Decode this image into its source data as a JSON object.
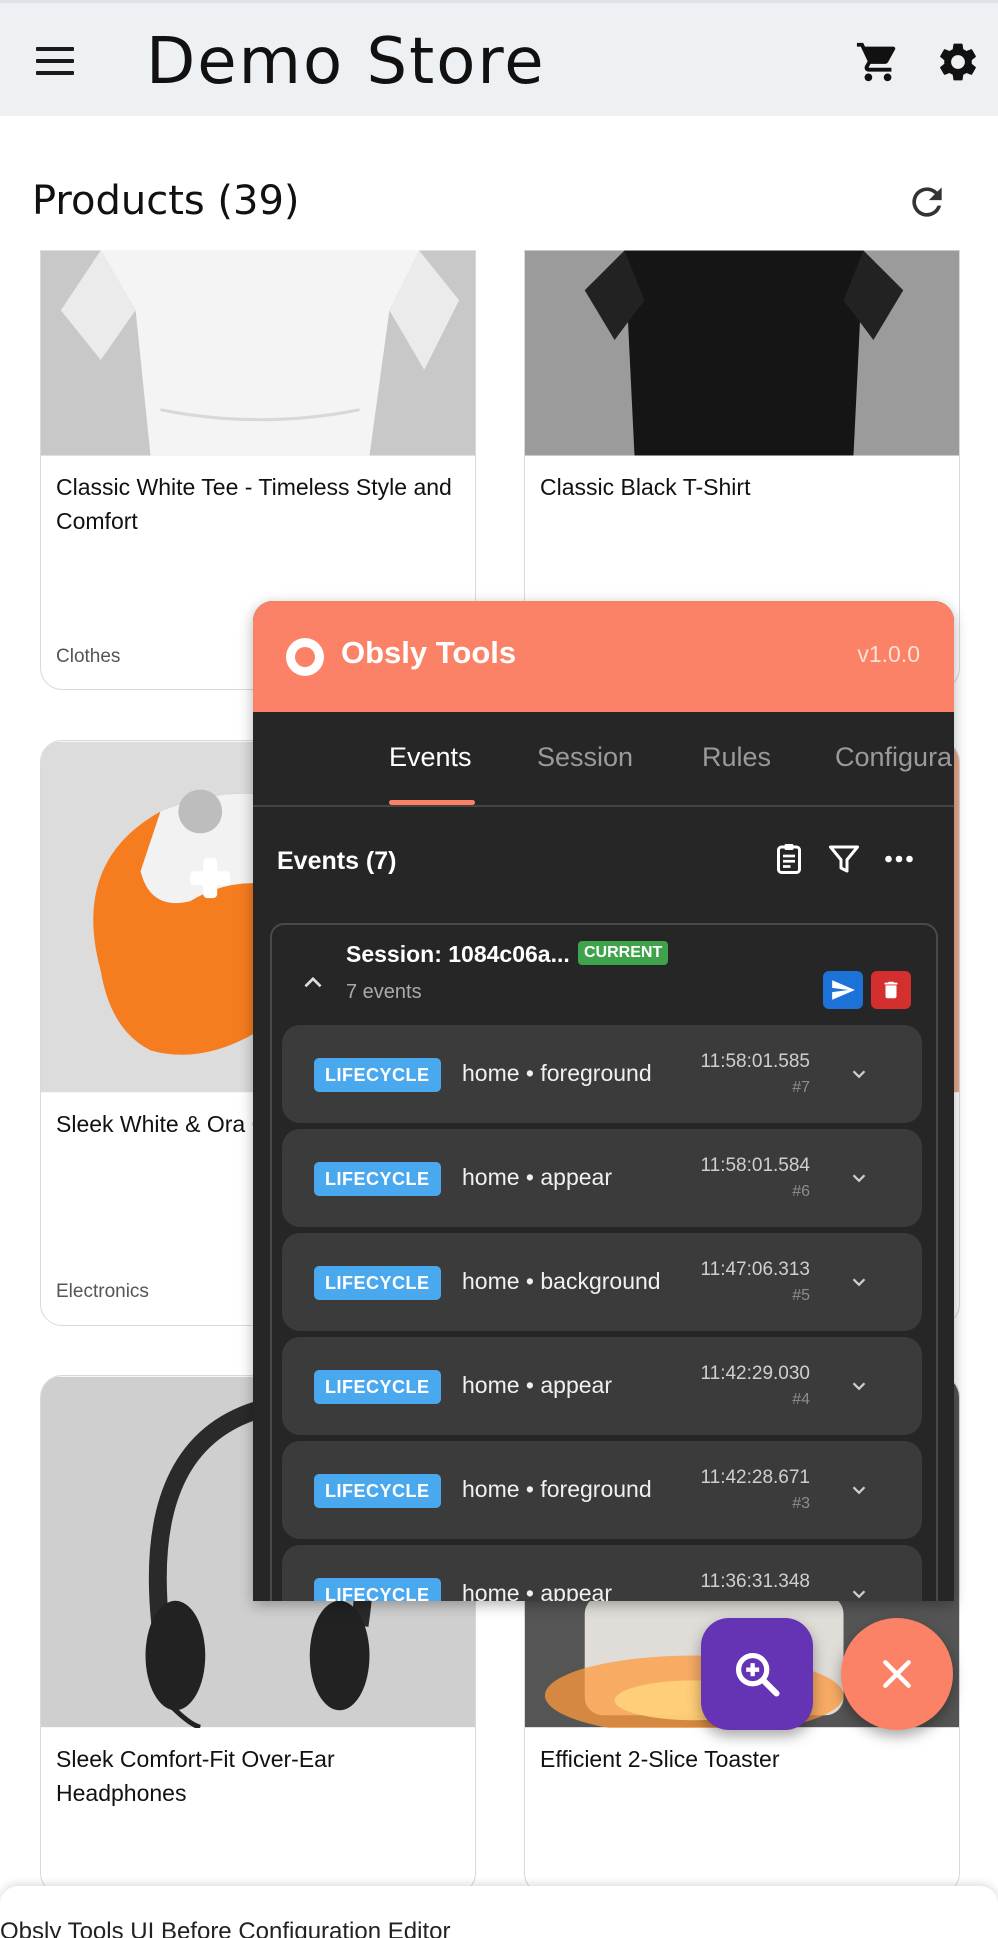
{
  "appbar": {
    "title": "Demo Store"
  },
  "products": {
    "heading": "Products (39)",
    "items": [
      {
        "name": "Classic White Tee - Timeless Style and Comfort",
        "category": "Clothes"
      },
      {
        "name": "Classic Black T-Shirt",
        "category": ""
      },
      {
        "name": "Sleek White & Ora Gaming Controller",
        "category": "Electronics"
      },
      {
        "name": "Sleek Comfort-Fit Over-Ear Headphones",
        "category": ""
      },
      {
        "name": "Efficient 2-Slice Toaster",
        "category": ""
      }
    ]
  },
  "tools": {
    "title": "Obsly Tools",
    "version": "v1.0.0",
    "tabs": [
      "Events",
      "Session",
      "Rules",
      "Configura"
    ],
    "events_heading": "Events (7)",
    "session": {
      "name": "Session: 1084c06a...",
      "badge": "CURRENT",
      "count": "7 events"
    },
    "events": [
      {
        "tag": "LIFECYCLE",
        "label": "home • foreground",
        "time": "11:58:01.585",
        "num": "#7"
      },
      {
        "tag": "LIFECYCLE",
        "label": "home • appear",
        "time": "11:58:01.584",
        "num": "#6"
      },
      {
        "tag": "LIFECYCLE",
        "label": "home • background",
        "time": "11:47:06.313",
        "num": "#5"
      },
      {
        "tag": "LIFECYCLE",
        "label": "home • appear",
        "time": "11:42:29.030",
        "num": "#4"
      },
      {
        "tag": "LIFECYCLE",
        "label": "home • foreground",
        "time": "11:42:28.671",
        "num": "#3"
      },
      {
        "tag": "LIFECYCLE",
        "label": "home • appear",
        "time": "11:36:31.348",
        "num": ""
      }
    ]
  },
  "bottom_text": "Obsly Tools UI Before Configuration Editor",
  "colors": {
    "accent": "#fb8266",
    "panel": "#262626",
    "tag": "#4aa8ef",
    "badge": "#3ea34a",
    "fab_search": "#6434b4",
    "send": "#1d72d8",
    "delete": "#d32f2f"
  }
}
